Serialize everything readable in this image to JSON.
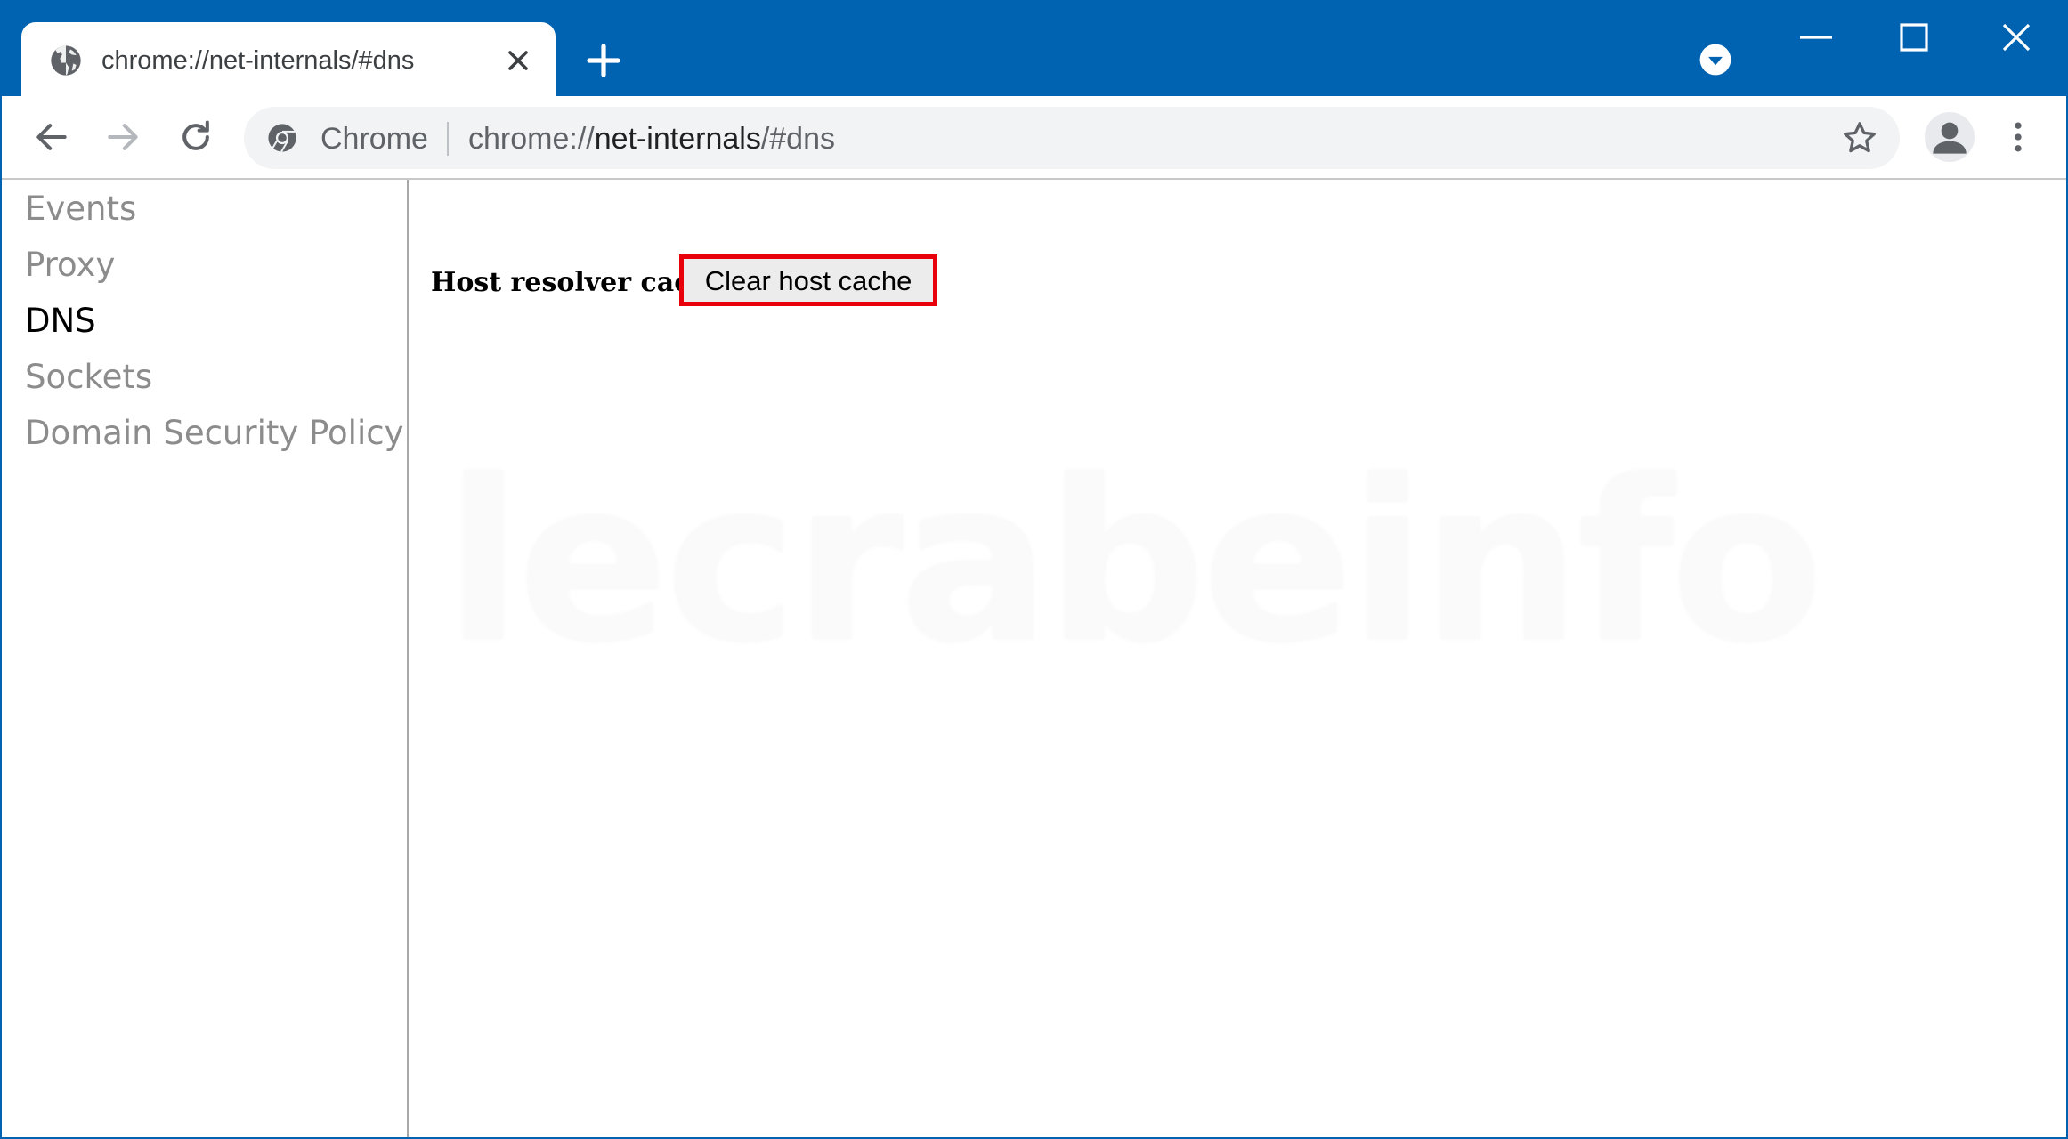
{
  "browser": {
    "tab": {
      "title": "chrome://net-internals/#dns",
      "favicon": "globe-icon"
    },
    "omnibox": {
      "label": "Chrome",
      "url_prefix": "chrome://",
      "url_host": "net-internals",
      "url_path": "/#dns"
    },
    "colors": {
      "frame": "#0063b1",
      "omnibox_bg": "#f1f3f4"
    }
  },
  "sidebar": {
    "items": [
      {
        "label": "Events",
        "active": false
      },
      {
        "label": "Proxy",
        "active": false
      },
      {
        "label": "DNS",
        "active": true
      },
      {
        "label": "Sockets",
        "active": false
      },
      {
        "label": "Domain Security Policy",
        "active": false
      }
    ]
  },
  "main": {
    "host_resolver_label": "Host resolver cache",
    "clear_button_label": "Clear host cache",
    "highlight_color": "#e8000b",
    "watermark": "lecrabeinfo"
  }
}
